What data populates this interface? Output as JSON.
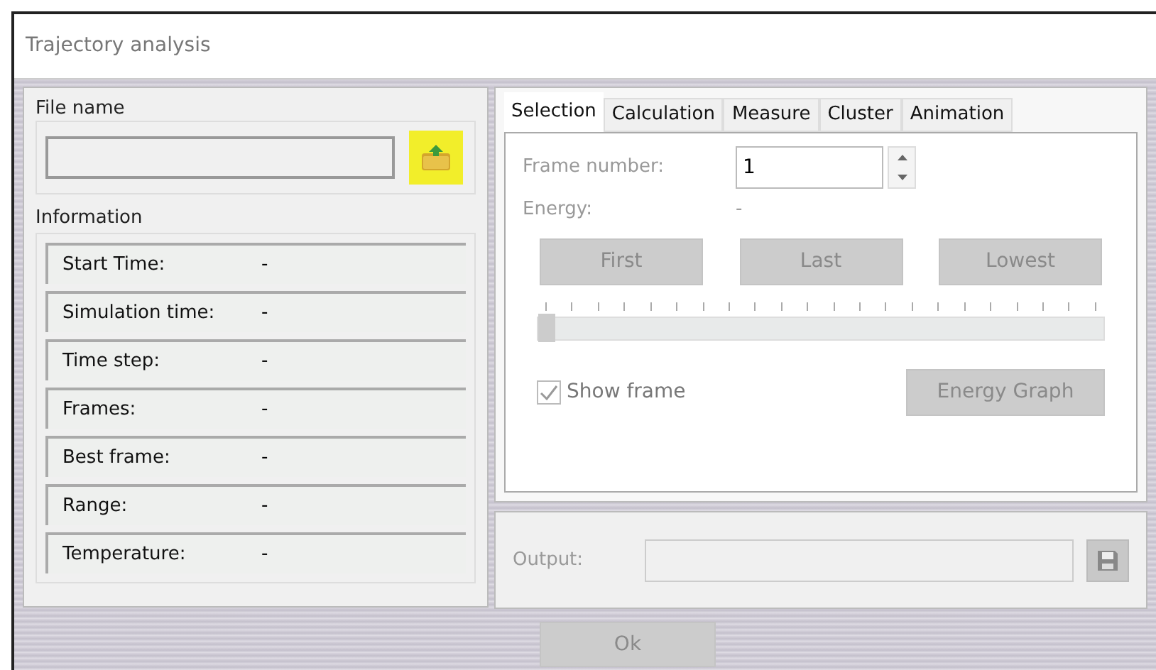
{
  "window": {
    "title": "Trajectory analysis"
  },
  "file_name": {
    "label": "File name"
  },
  "information": {
    "label": "Information",
    "rows": [
      {
        "label": "Start Time:",
        "value": "-"
      },
      {
        "label": "Simulation time:",
        "value": "-"
      },
      {
        "label": "Time step:",
        "value": "-"
      },
      {
        "label": "Frames:",
        "value": "-"
      },
      {
        "label": "Best frame:",
        "value": "-"
      },
      {
        "label": "Range:",
        "value": "-"
      },
      {
        "label": "Temperature:",
        "value": "-"
      }
    ]
  },
  "tabs": [
    {
      "label": "Selection",
      "selected": true
    },
    {
      "label": "Calculation",
      "selected": false
    },
    {
      "label": "Measure",
      "selected": false
    },
    {
      "label": "Cluster",
      "selected": false
    },
    {
      "label": "Animation",
      "selected": false
    }
  ],
  "selection": {
    "frame_label": "Frame number:",
    "frame_value": "1",
    "energy_label": "Energy:",
    "energy_value": "-",
    "buttons": [
      {
        "label": "First",
        "disabled": true
      },
      {
        "label": "Last",
        "disabled": true
      },
      {
        "label": "Lowest",
        "disabled": true
      }
    ],
    "slider": {
      "level": 0,
      "disabled": true
    },
    "show_frame": {
      "label": "Show frame",
      "checked": true,
      "disabled": true
    },
    "graph_button": {
      "label": "Energy Graph",
      "disabled": true
    }
  },
  "output": {
    "label": "Output:"
  },
  "ok_button": {
    "label": "Ok",
    "disabled": true
  }
}
